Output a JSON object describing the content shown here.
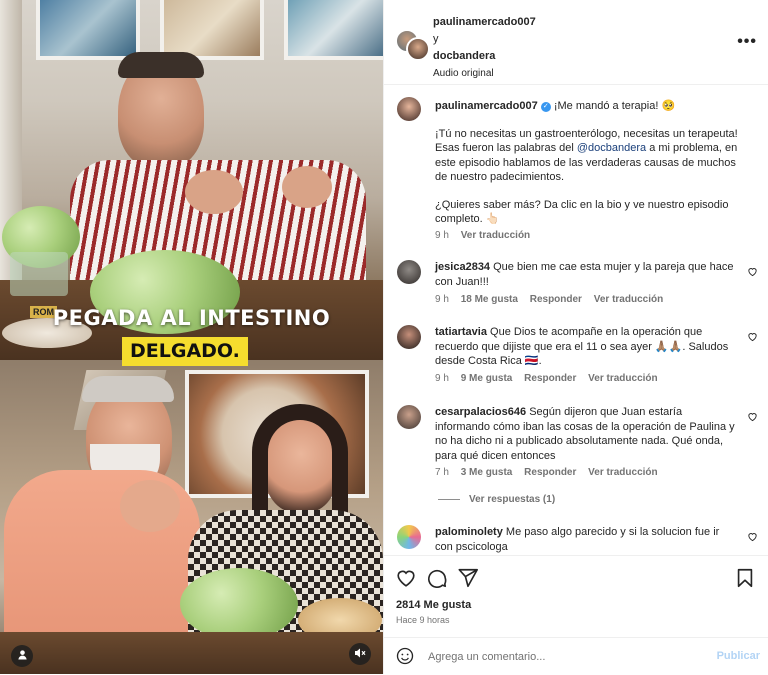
{
  "video": {
    "caption_line1": "PEGADA AL INTESTINO",
    "caption_line2": "DELGADO.",
    "sign_text": "ROM",
    "user_icon": "person-icon",
    "mute_icon": "speaker-muted-icon"
  },
  "header": {
    "author1": "paulinamercado007",
    "joiner": "y",
    "author2": "docbandera",
    "audio": "Audio original",
    "more_icon": "more-horizontal-icon"
  },
  "caption": {
    "username": "paulinamercado007",
    "verified": true,
    "headline": "¡Me mandó a terapia! 🥺",
    "p1_before": "¡Tú no necesitas un gastroenterólogo, necesitas un terapeuta! Esas fueron las palabras del ",
    "mention": "@docbandera",
    "p1_after": " a mi problema, en este episodio hablamos de las verdaderas causas de muchos de nuestro padecimientos.",
    "p2": "¿Quieres saber más? Da clic en la bio y ve nuestro episodio completo. 👆🏻",
    "time": "9 h",
    "translate": "Ver traducción"
  },
  "comments": [
    {
      "username": "jesica2834",
      "text": "Que bien me cae esta mujer y la pareja que hace con Juan!!!",
      "time": "9 h",
      "likes": "18 Me gusta",
      "reply": "Responder",
      "translate": "Ver traducción"
    },
    {
      "username": "tatiartavia",
      "text": "Que Dios te acompañe en la operación que recuerdo que dijiste que era el 11 o sea ayer 🙏🏽🙏🏽. Saludos desde Costa Rica 🇨🇷.",
      "time": "9 h",
      "likes": "9 Me gusta",
      "reply": "Responder",
      "translate": "Ver traducción"
    },
    {
      "username": "cesarpalacios646",
      "text": "Según dijeron que Juan estaría informando cómo iban las cosas de la operación de Paulina y no ha dicho ni a publicado absolutamente nada. Qué onda, para qué dicen entonces",
      "time": "7 h",
      "likes": "3 Me gusta",
      "reply": "Responder",
      "translate": "Ver traducción",
      "view_replies": "Ver respuestas (1)"
    },
    {
      "username": "palominolety",
      "text": "Me paso algo parecido y si la solucion fue ir con pscicologa"
    }
  ],
  "actions": {
    "like_icon": "heart-icon",
    "comment_icon": "comment-icon",
    "share_icon": "send-icon",
    "save_icon": "bookmark-icon",
    "likes": "2814 Me gusta",
    "time": "Hace 9 horas"
  },
  "composer": {
    "emoji_icon": "emoji-icon",
    "placeholder": "Agrega un comentario...",
    "post_label": "Publicar"
  },
  "colors": {
    "accent": "#0095f6",
    "post_disabled": "#b3d4f5",
    "caption_bg": "#f5dd2e",
    "muted": "#737373"
  }
}
